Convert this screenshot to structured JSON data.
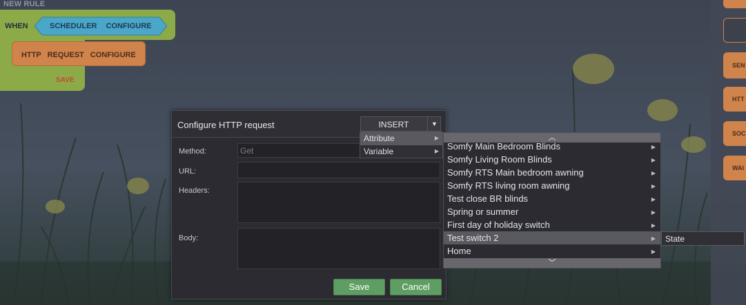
{
  "rule": {
    "title": "NEW RULE",
    "when_label": "WHEN",
    "trigger_block": "SCHEDULER CONFIGURE",
    "action_block": "HTTP REQUEST CONFIGURE",
    "save_label": "SAVE"
  },
  "palette": {
    "items": [
      "",
      "",
      "SEN",
      "HTT",
      "SOC",
      "WAI"
    ]
  },
  "dialog": {
    "title": "Configure HTTP request",
    "insert_label": "INSERT",
    "fields": {
      "method_label": "Method:",
      "method_value": "Get",
      "url_label": "URL:",
      "url_value": "",
      "headers_label": "Headers:",
      "headers_value": "",
      "body_label": "Body:",
      "body_value": ""
    },
    "save_button": "Save",
    "cancel_button": "Cancel"
  },
  "insert_menu": {
    "items": [
      {
        "label": "Attribute",
        "highlighted": true
      },
      {
        "label": "Variable",
        "highlighted": false
      }
    ]
  },
  "attribute_menu": {
    "items": [
      {
        "label": "Somfy Main Bedroom Blinds",
        "highlighted": false
      },
      {
        "label": "Somfy Living Room Blinds",
        "highlighted": false
      },
      {
        "label": "Somfy RTS Main bedroom awning",
        "highlighted": false
      },
      {
        "label": "Somfy RTS living room awning",
        "highlighted": false
      },
      {
        "label": "Test close BR blinds",
        "highlighted": false
      },
      {
        "label": "Spring or summer",
        "highlighted": false
      },
      {
        "label": "First day of holiday switch",
        "highlighted": false
      },
      {
        "label": "Test switch 2",
        "highlighted": true
      },
      {
        "label": "Home",
        "highlighted": false
      }
    ]
  },
  "state_menu": {
    "items": [
      "State"
    ]
  },
  "colors": {
    "rule_green": "#8cab48",
    "trigger_blue": "#4aa7c9",
    "action_orange": "#d0834a",
    "button_green": "#5f9e62",
    "dialog_bg": "#2b2b31",
    "menu_highlight": "#595960"
  },
  "icons": {
    "insert_caret": "caret-down-icon",
    "submenu_arrow": "triangle-right-icon",
    "scroll_up": "chevron-up-icon",
    "scroll_down": "chevron-down-icon"
  }
}
